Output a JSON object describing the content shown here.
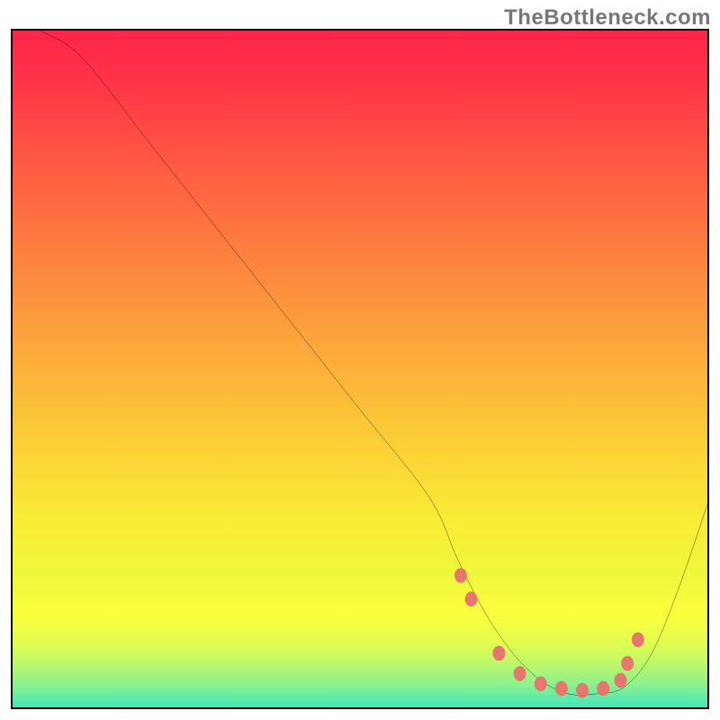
{
  "watermark": "TheBottleneck.com",
  "chart_data": {
    "type": "line",
    "title": "",
    "xlabel": "",
    "ylabel": "",
    "xlim": [
      0,
      100
    ],
    "ylim": [
      0,
      100
    ],
    "series": [
      {
        "name": "curve",
        "color": "#000000",
        "x": [
          4,
          10,
          20,
          30,
          40,
          50,
          60,
          64,
          68,
          72,
          76,
          80,
          84,
          88,
          92,
          96,
          100
        ],
        "y": [
          100,
          96,
          83,
          70,
          57,
          44,
          31,
          22,
          14,
          8,
          4,
          2,
          2,
          3,
          8,
          18,
          30
        ]
      }
    ],
    "markers": {
      "name": "trough-markers",
      "color": "#E7766F",
      "x": [
        64.5,
        66.0,
        70.0,
        73.0,
        76.0,
        79.0,
        82.0,
        85.0,
        87.5,
        88.5,
        90.0
      ],
      "y": [
        19.5,
        16.0,
        8.0,
        5.0,
        3.5,
        2.8,
        2.5,
        2.8,
        4.0,
        6.5,
        10.0
      ]
    },
    "gradient_stops": [
      {
        "offset": 0.0,
        "color": "#FF2449"
      },
      {
        "offset": 0.08,
        "color": "#FF3647"
      },
      {
        "offset": 0.2,
        "color": "#FE5C43"
      },
      {
        "offset": 0.32,
        "color": "#FD803F"
      },
      {
        "offset": 0.45,
        "color": "#FCA63B"
      },
      {
        "offset": 0.58,
        "color": "#FBCB37"
      },
      {
        "offset": 0.7,
        "color": "#FAEB34"
      },
      {
        "offset": 0.78,
        "color": "#EFF73B"
      },
      {
        "offset": 0.84,
        "color": "#FBFF3D"
      },
      {
        "offset": 0.88,
        "color": "#E3FD4E"
      },
      {
        "offset": 0.91,
        "color": "#BFF869"
      },
      {
        "offset": 0.94,
        "color": "#8DF18C"
      },
      {
        "offset": 0.97,
        "color": "#4BE7B6"
      },
      {
        "offset": 1.0,
        "color": "#17DFD8"
      }
    ]
  }
}
